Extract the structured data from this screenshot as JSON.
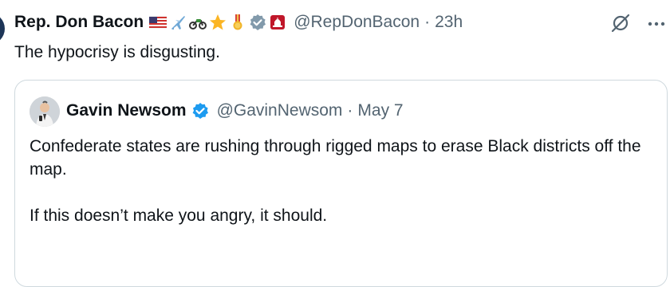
{
  "tweet": {
    "author_name": "Rep. Don Bacon",
    "name_emojis": [
      "us-flag-icon",
      "airplane-icon",
      "motorcycle-icon",
      "star-icon",
      "medal-icon",
      "verified-gray-icon",
      "capitol-icon"
    ],
    "handle": "@RepDonBacon",
    "separator": "·",
    "time": "23h",
    "text": "The hypocrisy is disgusting."
  },
  "quote": {
    "author_name": "Gavin Newsom",
    "handle": "@GavinNewsom",
    "separator": "·",
    "date": "May 7",
    "paragraphs": [
      "Confederate states are rushing through rigged maps to erase Black districts off the map.",
      "If this doesn’t make you angry, it should."
    ]
  },
  "colors": {
    "text_primary": "#0f1419",
    "text_secondary": "#536471",
    "verified_blue": "#1d9bf0",
    "border": "#cfd9de"
  }
}
